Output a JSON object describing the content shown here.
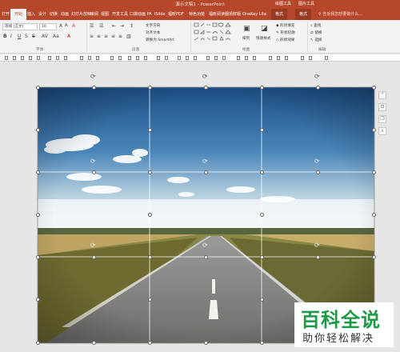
{
  "window": {
    "title": "演示文稿1 - PowerPoint",
    "context_groups": [
      "绘图工具",
      "图片工具"
    ]
  },
  "tabs": [
    "打开",
    "开始",
    "插入",
    "设计",
    "切换",
    "动画",
    "幻灯片放映",
    "审阅",
    "视图",
    "开发工具",
    "口袋动画 PA",
    "iSlide",
    "福昕PDF",
    "特色功能",
    "福昕阅读器领鲜版",
    "OneKey Lite",
    "格式",
    "格式"
  ],
  "tell_me": "告诉我您想要做什么...",
  "ribbon": {
    "font_name": "等线 (正文)",
    "font_size": "16",
    "bold": "B",
    "italic": "I",
    "underline": "U",
    "strike": "S",
    "shadow": "S",
    "text_direction": "文字方向",
    "align_text": "对齐文本",
    "smartart": "转换为 SmartArt",
    "arrange": "排列",
    "quick_styles": "快速样式",
    "shape_fill": "形状填充",
    "shape_outline": "形状轮廓",
    "shape_effects": "形状效果",
    "find": "查找",
    "replace": "替换",
    "select": "选择",
    "groups": [
      "字体",
      "段落",
      "绘图",
      "编辑"
    ]
  },
  "watermark": {
    "brand": "百科全说",
    "tagline": "助你轻松解决"
  },
  "colors": {
    "accent": "#b7472a",
    "watermark_green": "#1d9a45"
  },
  "icons": [
    "search-icon",
    "bold-icon",
    "italic-icon",
    "underline-icon",
    "font-color-icon",
    "align-left-icon",
    "align-center-icon",
    "align-right-icon",
    "shapes-gallery-icon",
    "rotate-handle-icon",
    "layout-options-icon",
    "find-icon",
    "replace-icon",
    "select-icon"
  ]
}
